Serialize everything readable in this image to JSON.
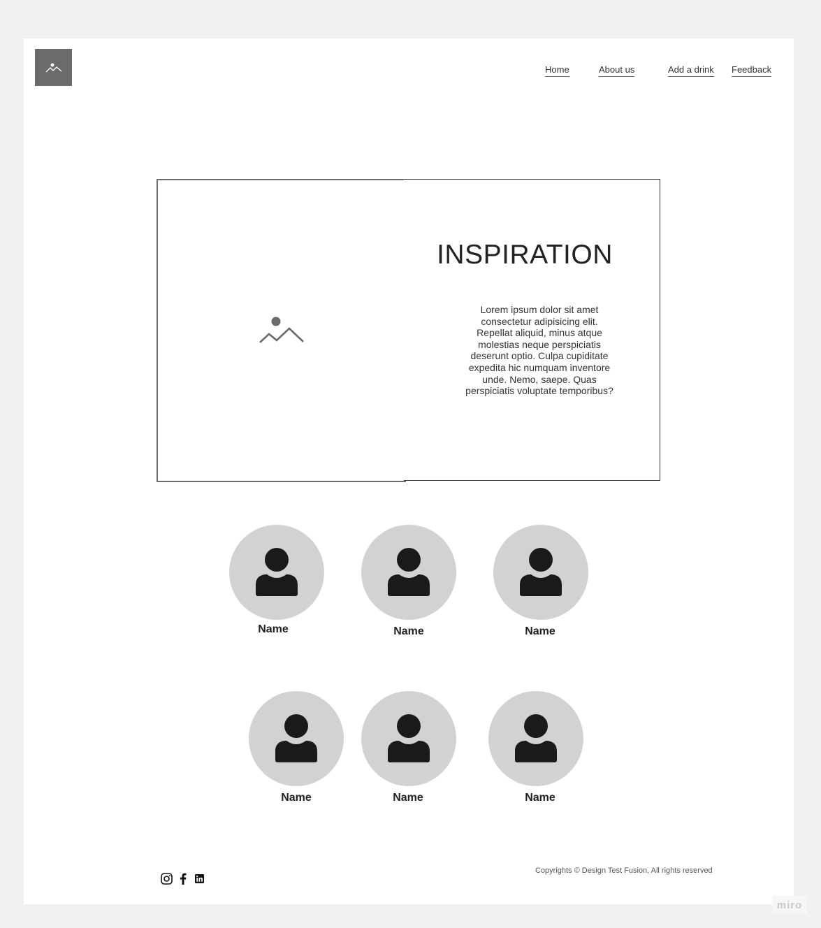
{
  "logo_icon": "image-placeholder-icon",
  "nav": {
    "home": "Home",
    "about": "About us",
    "add_drink": "Add a drink",
    "feedback": "Feedback"
  },
  "hero": {
    "image_icon": "image-placeholder-icon",
    "title": "INSPIRATION",
    "body": "Lorem ipsum dolor sit amet consectetur adipisicing elit. Repellat aliquid, minus atque molestias neque perspiciatis deserunt optio. Culpa cupiditate expedita hic numquam inventore unde. Nemo, saepe. Quas perspiciatis voluptate temporibus?"
  },
  "team": [
    {
      "name": "Name",
      "icon": "user-icon"
    },
    {
      "name": "Name",
      "icon": "user-icon"
    },
    {
      "name": "Name",
      "icon": "user-icon"
    },
    {
      "name": "Name",
      "icon": "user-icon"
    },
    {
      "name": "Name",
      "icon": "user-icon"
    },
    {
      "name": "Name",
      "icon": "user-icon"
    }
  ],
  "footer": {
    "social": [
      "instagram-icon",
      "facebook-icon",
      "linkedin-icon"
    ],
    "copyright": "Copyrights © Design Test Fusion, All rights reserved"
  },
  "watermark": "miro",
  "colors": {
    "background": "#f1f1f1",
    "avatar": "#d2d2d2",
    "placeholder": "#6b6b6b"
  }
}
